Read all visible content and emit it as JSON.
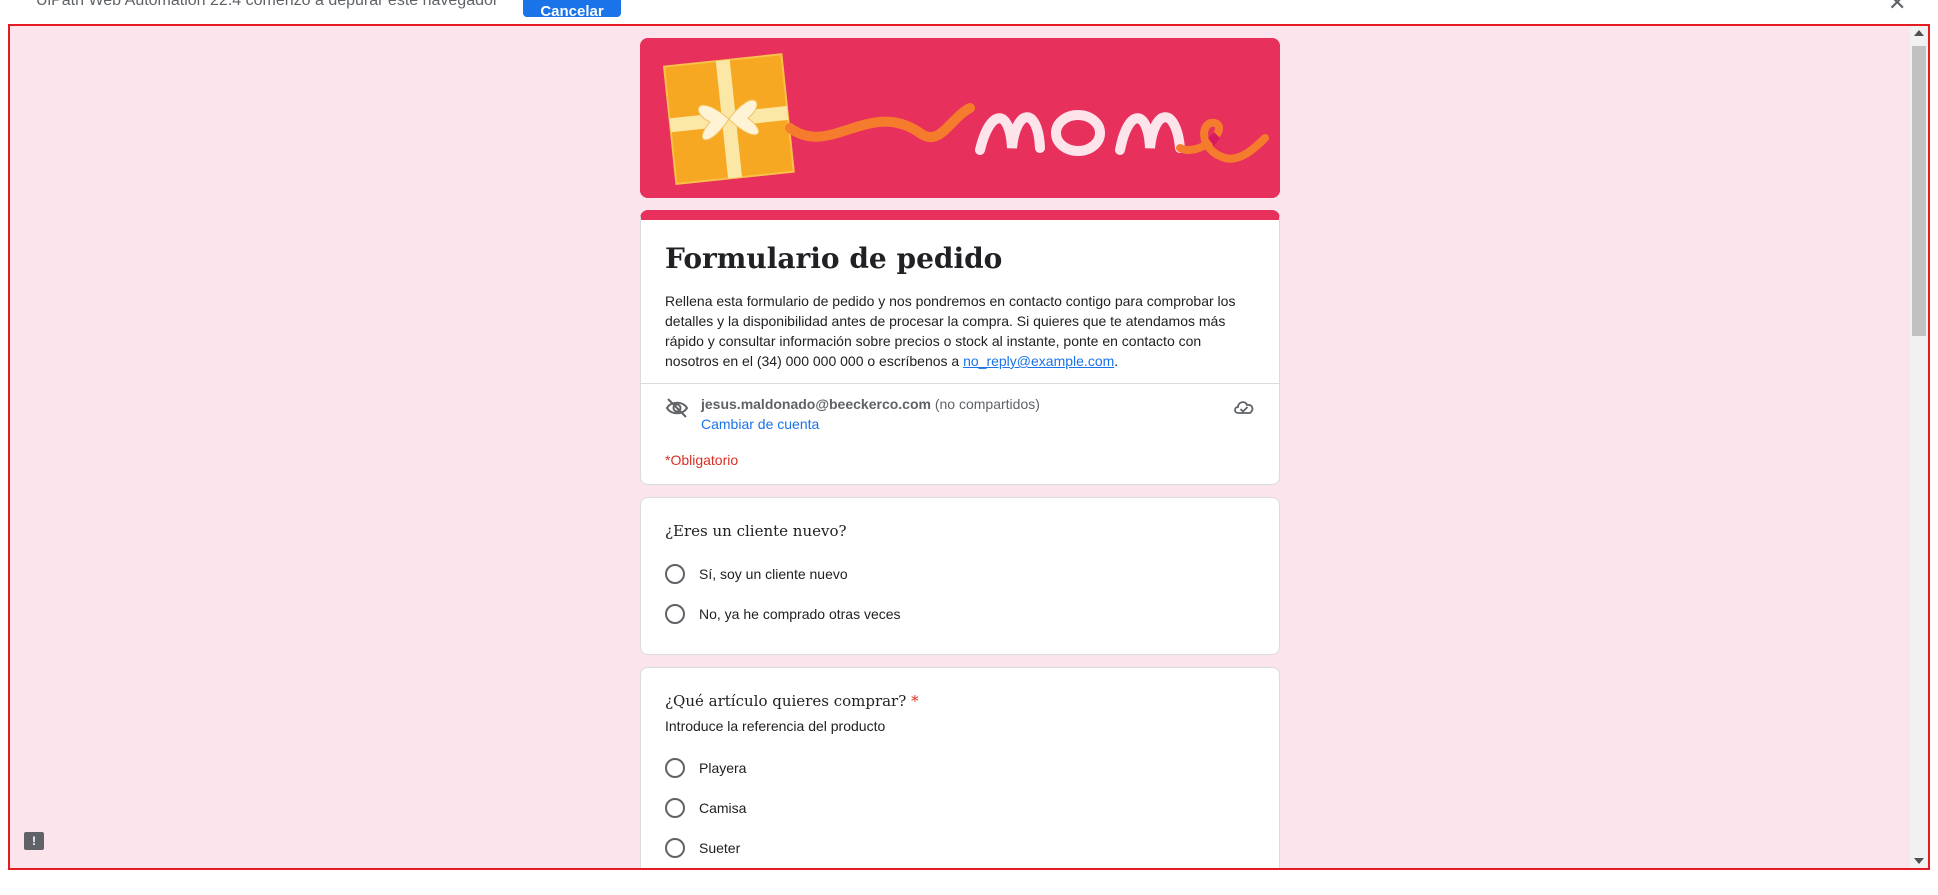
{
  "infobar": {
    "text": "UiPath Web Automation 22.4 comenzó a depurar este navegador",
    "cancel_label": "Cancelar",
    "close_glyph": "✕"
  },
  "colors": {
    "accent": "#e8305d",
    "page_bg": "#fce4ec",
    "link": "#1a73e8",
    "required": "#d93025"
  },
  "banner": {
    "lettering": "mom"
  },
  "form": {
    "title": "Formulario de pedido",
    "description": "Rellena esta formulario de pedido y nos pondremos en contacto contigo para comprobar los detalles y la disponibilidad antes de procesar la compra. Si quieres que te atendamos más rápido y consultar información sobre precios o stock al instante, ponte en contacto con nosotros en el (34) 000 000 000 o escríbenos a ",
    "email_link": "no_reply@example.com",
    "description_end": ".",
    "account_email": "jesus.maldonado@beeckerco.com",
    "account_note": " (no compartidos)",
    "switch_account": "Cambiar de cuenta",
    "required_note": "*Obligatorio"
  },
  "questions": [
    {
      "title": "¿Eres un cliente nuevo?",
      "options": [
        "Sí, soy un cliente nuevo",
        "No, ya he comprado otras veces"
      ]
    },
    {
      "title": "¿Qué artículo quieres comprar?",
      "required_mark": "*",
      "help": "Introduce la referencia del producto",
      "options": [
        "Playera",
        "Camisa",
        "Sueter"
      ]
    }
  ],
  "icons": [
    "eye-off-icon",
    "cloud-check-icon",
    "feedback-icon"
  ]
}
